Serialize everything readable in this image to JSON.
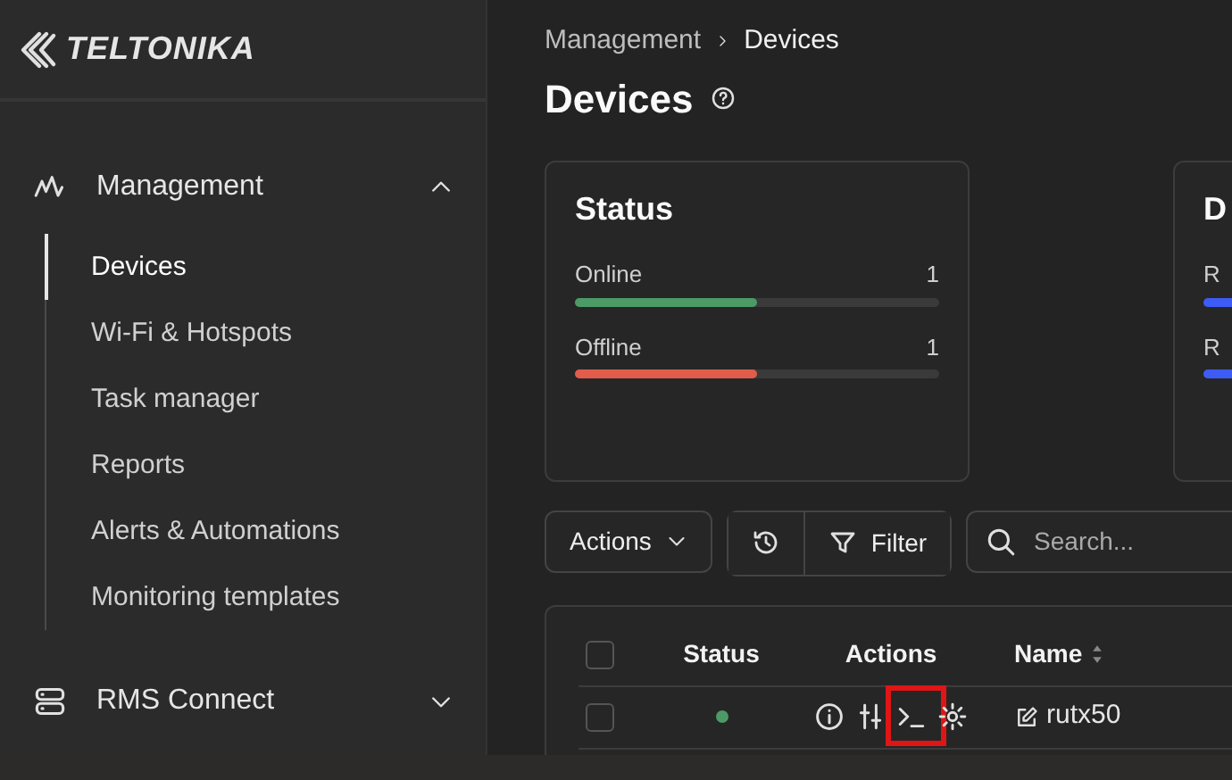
{
  "logo": {
    "text": "TELTONIKA"
  },
  "sidebar": {
    "sections": [
      {
        "label": "Management",
        "expanded": true,
        "items": [
          {
            "label": "Devices",
            "selected": true
          },
          {
            "label": "Wi-Fi & Hotspots",
            "selected": false
          },
          {
            "label": "Task manager",
            "selected": false
          },
          {
            "label": "Reports",
            "selected": false
          },
          {
            "label": "Alerts & Automations",
            "selected": false
          },
          {
            "label": "Monitoring templates",
            "selected": false
          }
        ]
      },
      {
        "label": "RMS Connect",
        "expanded": false
      }
    ]
  },
  "breadcrumb": [
    "Management",
    "Devices"
  ],
  "title": "Devices",
  "cards": [
    {
      "title": "Status",
      "rows": [
        {
          "label": "Online",
          "count": "1",
          "level": 0.5,
          "color": "#4c9a66"
        },
        {
          "label": "Offline",
          "count": "1",
          "level": 0.5,
          "color": "#e25c4b"
        }
      ]
    },
    {
      "title": "D",
      "rows": [
        {
          "label": "R",
          "level": 1,
          "color": "#3d5cf5"
        },
        {
          "label": "R",
          "level": 1,
          "color": "#3d5cf5"
        }
      ]
    }
  ],
  "toolbar": {
    "actions_button": "Actions",
    "filter_button": "Filter",
    "search": {
      "placeholder": "Search..."
    }
  },
  "table": {
    "select_all_checked": false,
    "columns": [
      {
        "label": "Status",
        "sortable": false
      },
      {
        "label": "Actions",
        "sortable": false
      },
      {
        "label": "Name",
        "sortable": true
      }
    ],
    "rows": [
      {
        "checked": false,
        "online": true,
        "actions": [
          {
            "kind": "info",
            "highlighted": false
          },
          {
            "kind": "sliders",
            "highlighted": false
          },
          {
            "kind": "terminal",
            "highlighted": true
          },
          {
            "kind": "gear",
            "highlighted": false
          }
        ],
        "name": "rutx50"
      }
    ]
  }
}
